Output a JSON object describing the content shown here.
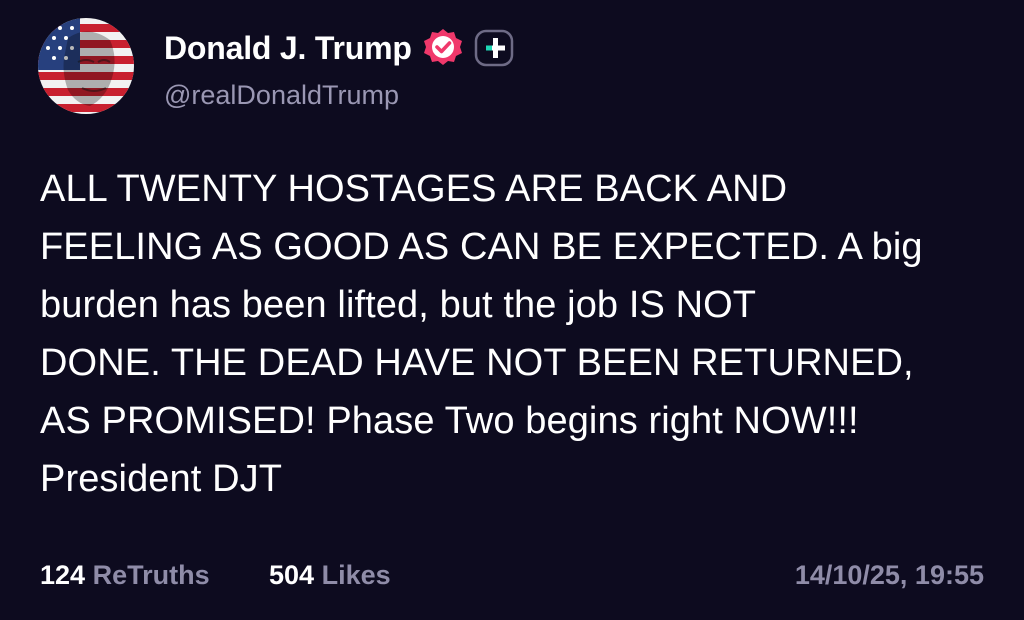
{
  "author": {
    "display_name": "Donald J. Trump",
    "handle": "@realDonaldTrump",
    "avatar_icon": "avatar-flag-portrait",
    "verified_icon": "verified-badge-icon",
    "verified_color": "#f0386b",
    "follow_icon": "plus-badge-icon",
    "follow_color": "#1ed7b5"
  },
  "post": {
    "lines": [
      "ALL TWENTY HOSTAGES ARE BACK AND",
      "FEELING AS GOOD AS CAN BE EXPECTED. A big",
      "burden has been lifted, but the job IS NOT",
      "DONE. THE DEAD HAVE NOT BEEN RETURNED,",
      "AS PROMISED! Phase Two begins right NOW!!!",
      "President DJT"
    ]
  },
  "stats": {
    "retruths_count": "124",
    "retruths_label": "ReTruths",
    "likes_count": "504",
    "likes_label": "Likes",
    "timestamp": "14/10/25, 19:55"
  },
  "colors": {
    "background": "#0d0b1f",
    "text": "#ffffff",
    "muted": "#8f8ca8"
  }
}
